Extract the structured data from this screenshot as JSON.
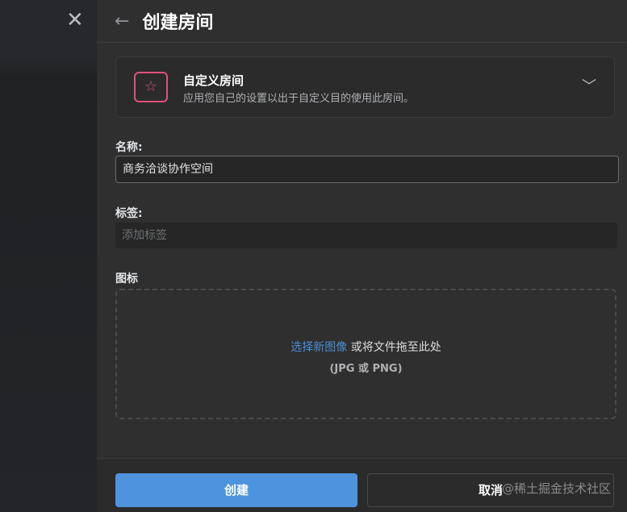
{
  "header": {
    "title": "创建房间"
  },
  "template": {
    "title": "自定义房间",
    "description": "应用您自己的设置以出于自定义目的使用此房间。"
  },
  "name": {
    "label": "名称:",
    "value": "商务洽谈协作空间"
  },
  "tags": {
    "label": "标签:",
    "placeholder": "添加标签"
  },
  "icon": {
    "label": "图标",
    "select_link": "选择新图像",
    "drop_text": " 或将文件拖至此处",
    "formats": "(JPG 或 PNG)"
  },
  "footer": {
    "create": "创建",
    "cancel": "取消"
  },
  "watermark": "@稀土掘金技术社区"
}
